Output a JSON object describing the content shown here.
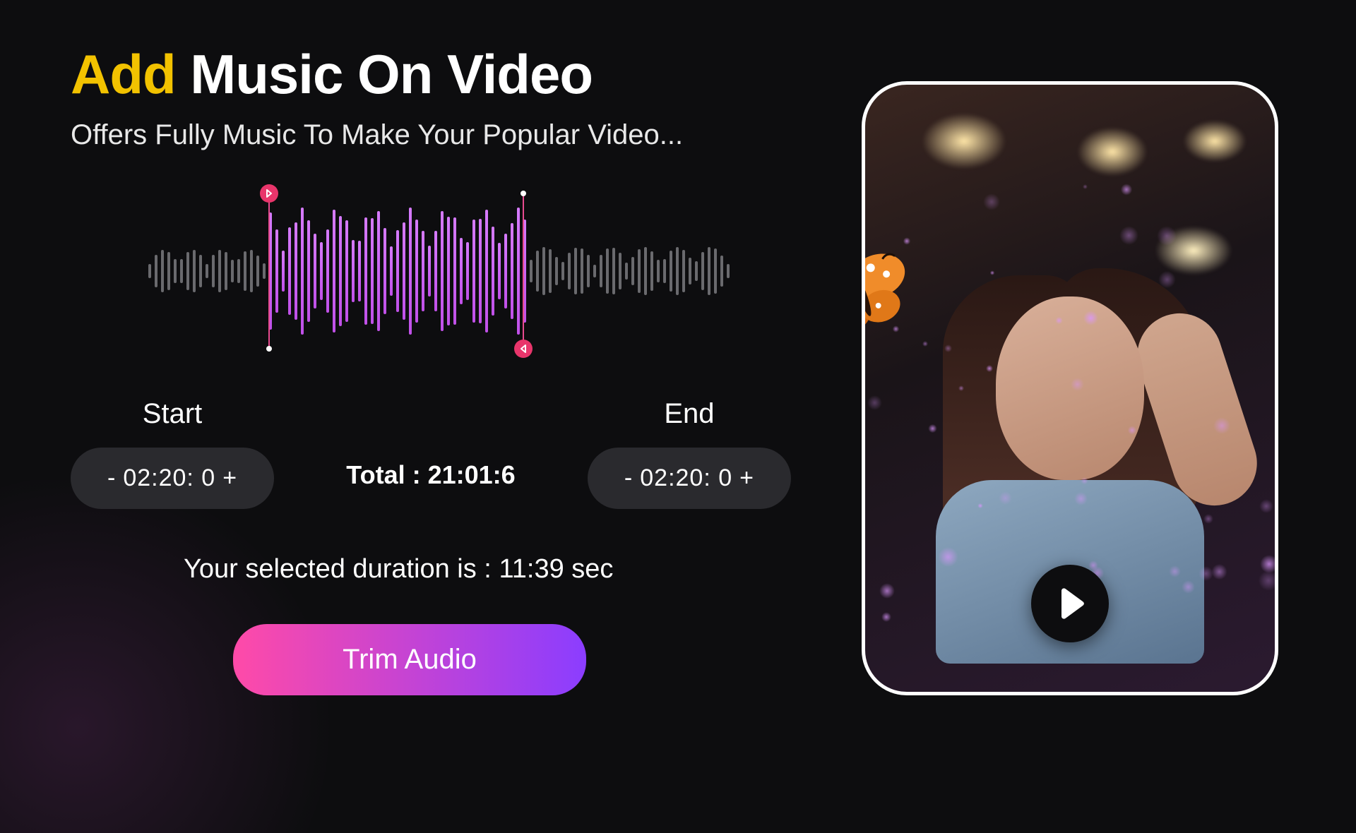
{
  "title_accent": "Add",
  "title_rest": " Music On Video",
  "subtitle": "Offers Fully Music To Make Your Popular Video...",
  "start": {
    "label": "Start",
    "minus": "-",
    "value": "02:20: 0",
    "plus": "+"
  },
  "end": {
    "label": "End",
    "minus": "-",
    "value": "02:20: 0",
    "plus": "+"
  },
  "total_label": "Total : ",
  "total_value": "21:01:6",
  "duration_msg_prefix": "Your selected duration is : ",
  "duration_value": "11:39 sec",
  "trim_button": "Trim Audio"
}
